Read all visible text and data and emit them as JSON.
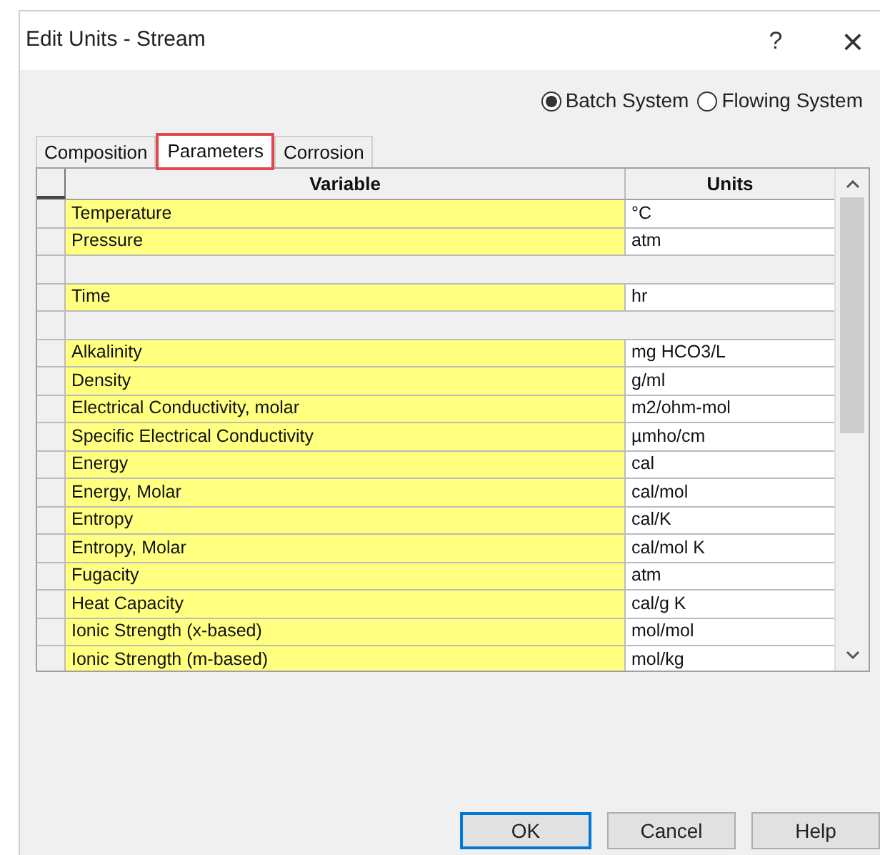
{
  "window": {
    "title": "Edit Units - Stream",
    "help": "?",
    "close": "×"
  },
  "system": [
    {
      "label": "Batch System",
      "selected": true
    },
    {
      "label": "Flowing System",
      "selected": false
    }
  ],
  "tabs": [
    {
      "label": "Composition",
      "selected": false
    },
    {
      "label": "Parameters",
      "selected": true
    },
    {
      "label": "Corrosion",
      "selected": false
    }
  ],
  "table": {
    "columns": [
      "Variable",
      "Units"
    ],
    "rows": [
      {
        "kind": "data",
        "variable": "Temperature",
        "units": "°C"
      },
      {
        "kind": "data",
        "variable": "Pressure",
        "units": "atm"
      },
      {
        "kind": "blank"
      },
      {
        "kind": "data",
        "variable": "Time",
        "units": "hr"
      },
      {
        "kind": "blank"
      },
      {
        "kind": "data",
        "variable": "Alkalinity",
        "units": "mg HCO3/L"
      },
      {
        "kind": "data",
        "variable": "Density",
        "units": "g/ml"
      },
      {
        "kind": "data",
        "variable": "Electrical Conductivity, molar",
        "units": "m2/ohm-mol"
      },
      {
        "kind": "data",
        "variable": "Specific Electrical Conductivity",
        "units": "µmho/cm"
      },
      {
        "kind": "data",
        "variable": "Energy",
        "units": "cal"
      },
      {
        "kind": "data",
        "variable": "Energy, Molar",
        "units": "cal/mol"
      },
      {
        "kind": "data",
        "variable": "Entropy",
        "units": "cal/K"
      },
      {
        "kind": "data",
        "variable": "Entropy, Molar",
        "units": "cal/mol K"
      },
      {
        "kind": "data",
        "variable": "Fugacity",
        "units": "atm"
      },
      {
        "kind": "data",
        "variable": "Heat Capacity",
        "units": "cal/g K"
      },
      {
        "kind": "data",
        "variable": "Ionic Strength (x-based)",
        "units": "mol/mol"
      },
      {
        "kind": "data",
        "variable": "Ionic Strength (m-based)",
        "units": "mol/kg"
      }
    ]
  },
  "buttons": [
    {
      "label": "OK",
      "default": true
    },
    {
      "label": "Cancel",
      "default": false
    },
    {
      "label": "Help",
      "default": false
    }
  ]
}
